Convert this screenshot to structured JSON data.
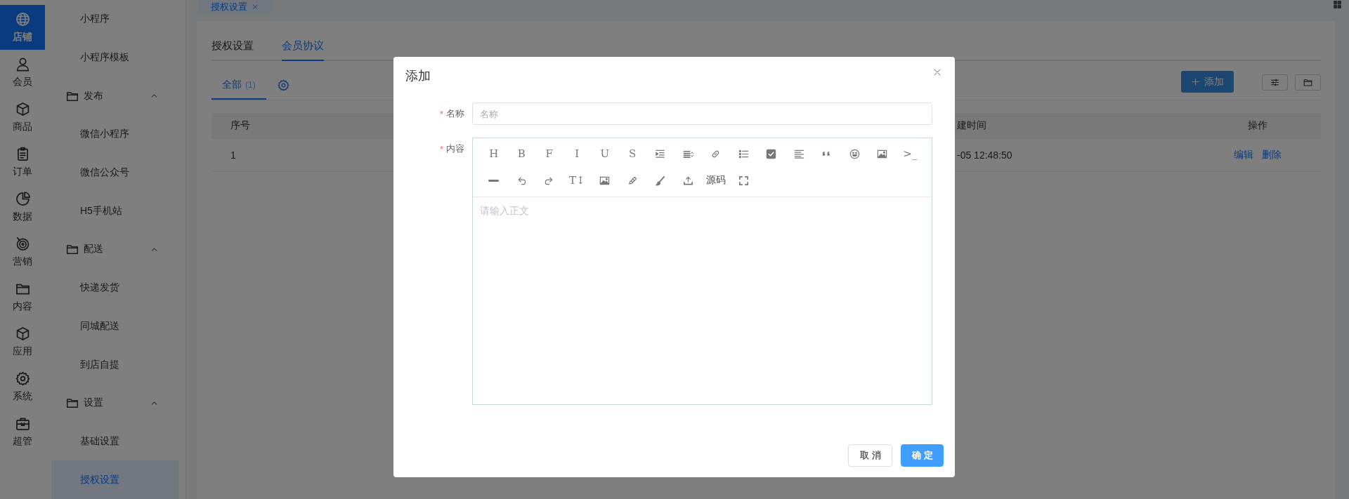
{
  "top_tabs": [
    {
      "label": "授权设置",
      "selected": true
    }
  ],
  "rail": [
    {
      "label": "店铺",
      "kind": "globe",
      "selected": true
    },
    {
      "label": "会员",
      "kind": "person",
      "selected": false
    },
    {
      "label": "商品",
      "kind": "cube",
      "selected": false
    },
    {
      "label": "订单",
      "kind": "clipboard",
      "selected": false
    },
    {
      "label": "数据",
      "kind": "pie",
      "selected": false
    },
    {
      "label": "营销",
      "kind": "target",
      "selected": false
    },
    {
      "label": "内容",
      "kind": "folder",
      "selected": false
    },
    {
      "label": "应用",
      "kind": "cube",
      "selected": false
    },
    {
      "label": "系统",
      "kind": "gear",
      "selected": false
    },
    {
      "label": "超管",
      "kind": "toolbox",
      "selected": false
    }
  ],
  "sidebar": [
    {
      "kind": "item",
      "label": "小程序",
      "selected": false
    },
    {
      "kind": "item",
      "label": "小程序模板",
      "selected": false
    },
    {
      "kind": "section",
      "label": "发布",
      "expanded": true
    },
    {
      "kind": "item",
      "label": "微信小程序",
      "selected": false
    },
    {
      "kind": "item",
      "label": "微信公众号",
      "selected": false
    },
    {
      "kind": "item",
      "label": "H5手机站",
      "selected": false
    },
    {
      "kind": "section",
      "label": "配送",
      "expanded": true
    },
    {
      "kind": "item",
      "label": "快递发货",
      "selected": false
    },
    {
      "kind": "item",
      "label": "同城配送",
      "selected": false
    },
    {
      "kind": "item",
      "label": "到店自提",
      "selected": false
    },
    {
      "kind": "section",
      "label": "设置",
      "expanded": true
    },
    {
      "kind": "item",
      "label": "基础设置",
      "selected": false
    },
    {
      "kind": "item",
      "label": "授权设置",
      "selected": true
    }
  ],
  "page_tabs": [
    {
      "label": "授权设置",
      "selected": false
    },
    {
      "label": "会员协议",
      "selected": true
    }
  ],
  "filter_tabs": [
    {
      "label": "全部",
      "count": "(1)",
      "selected": true
    }
  ],
  "add_button": "添加",
  "table": {
    "columns": [
      "序号",
      "建时间",
      "操作"
    ],
    "rows": [
      {
        "cells": [
          "1",
          "-05 12:48:50"
        ],
        "actions": [
          "编辑",
          "删除"
        ]
      }
    ]
  },
  "dialog": {
    "title": "添加",
    "fields": [
      {
        "label": "名称",
        "required_mark": "*",
        "placeholder": "名称"
      },
      {
        "label": "内容",
        "required_mark": "*"
      }
    ],
    "editor": {
      "placeholder": "请输入正文",
      "toolbar": [
        [
          {
            "kind": "text",
            "text": "H"
          },
          {
            "kind": "text",
            "text": "B"
          },
          {
            "kind": "text",
            "text": "F"
          },
          {
            "kind": "text",
            "text": "I"
          },
          {
            "kind": "text",
            "text": "U"
          },
          {
            "kind": "text",
            "text": "S"
          },
          {
            "kind": "indent"
          },
          {
            "kind": "line-height"
          },
          {
            "kind": "link"
          },
          {
            "kind": "list"
          },
          {
            "kind": "checkbox"
          },
          {
            "kind": "align"
          },
          {
            "kind": "quote"
          },
          {
            "kind": "emoji"
          },
          {
            "kind": "image"
          },
          {
            "kind": "text",
            "text": ">_"
          }
        ],
        [
          {
            "kind": "rule"
          },
          {
            "kind": "undo"
          },
          {
            "kind": "redo"
          },
          {
            "kind": "text",
            "text": "T↕"
          },
          {
            "kind": "image"
          },
          {
            "kind": "pencil"
          },
          {
            "kind": "brush"
          },
          {
            "kind": "upload"
          },
          {
            "kind": "text",
            "text": "源码"
          },
          {
            "kind": "fullscreen"
          }
        ]
      ]
    },
    "buttons": [
      {
        "label": "取消",
        "kind": "default"
      },
      {
        "label": "确定",
        "kind": "primary"
      }
    ]
  }
}
